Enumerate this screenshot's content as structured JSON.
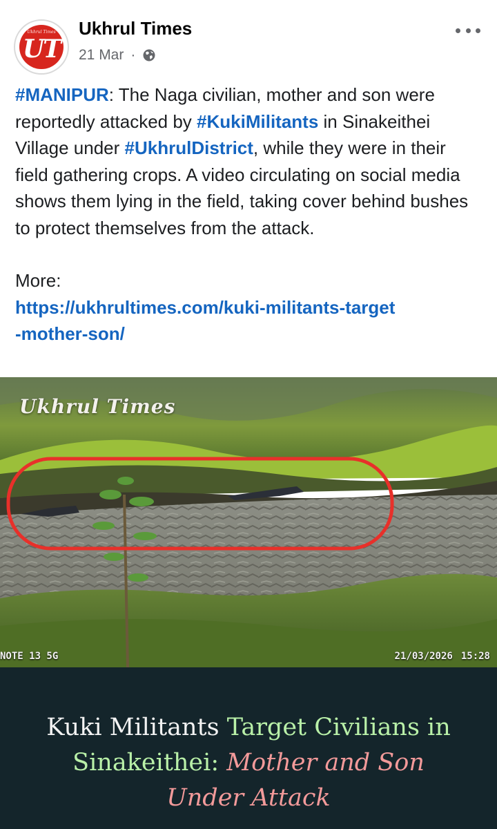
{
  "post": {
    "page_name": "Ukhrul Times",
    "date": "21 Mar",
    "separator": "·",
    "privacy_icon": "globe-icon",
    "more_icon": "more-horizontal-icon",
    "avatar": {
      "mini_text": "Ukhrul Times",
      "mark": "UT"
    }
  },
  "text": {
    "hashtag_manipur": "#MANIPUR",
    "part1": ": The Naga civilian, mother and son were reportedly attacked by ",
    "hashtag_kuki": "#KukiMilitants",
    "part2": " in Sinakeithei Village under ",
    "hashtag_ukhrul": "#UkhrulDistrict",
    "part3": ", while they were in their field gathering crops. A video circulating on social media shows them lying in the field, taking cover behind bushes to protect themselves from the attack.",
    "more_label": "More:",
    "link_line1": "https://ukhrultimes.com/kuki-militants-target",
    "link_line2": "-mother-son/"
  },
  "image": {
    "watermark": "Ukhrul Times",
    "camera_model": "NOTE 13 5G",
    "camera_date": "21/03/2026",
    "camera_time": "15:28"
  },
  "headline": {
    "white": "Kuki Militants ",
    "green_1": "Target Civilians in",
    "green_2": "Sinakeithei: ",
    "pink_1": "Mother and Son",
    "pink_2": "Under Attack"
  },
  "colors": {
    "hashtag": "#1565c0",
    "banner_bg": "#14252b",
    "headline_green": "#b9f0a8",
    "headline_pink": "#f39a9a",
    "highlight_circle": "#e8302a"
  }
}
